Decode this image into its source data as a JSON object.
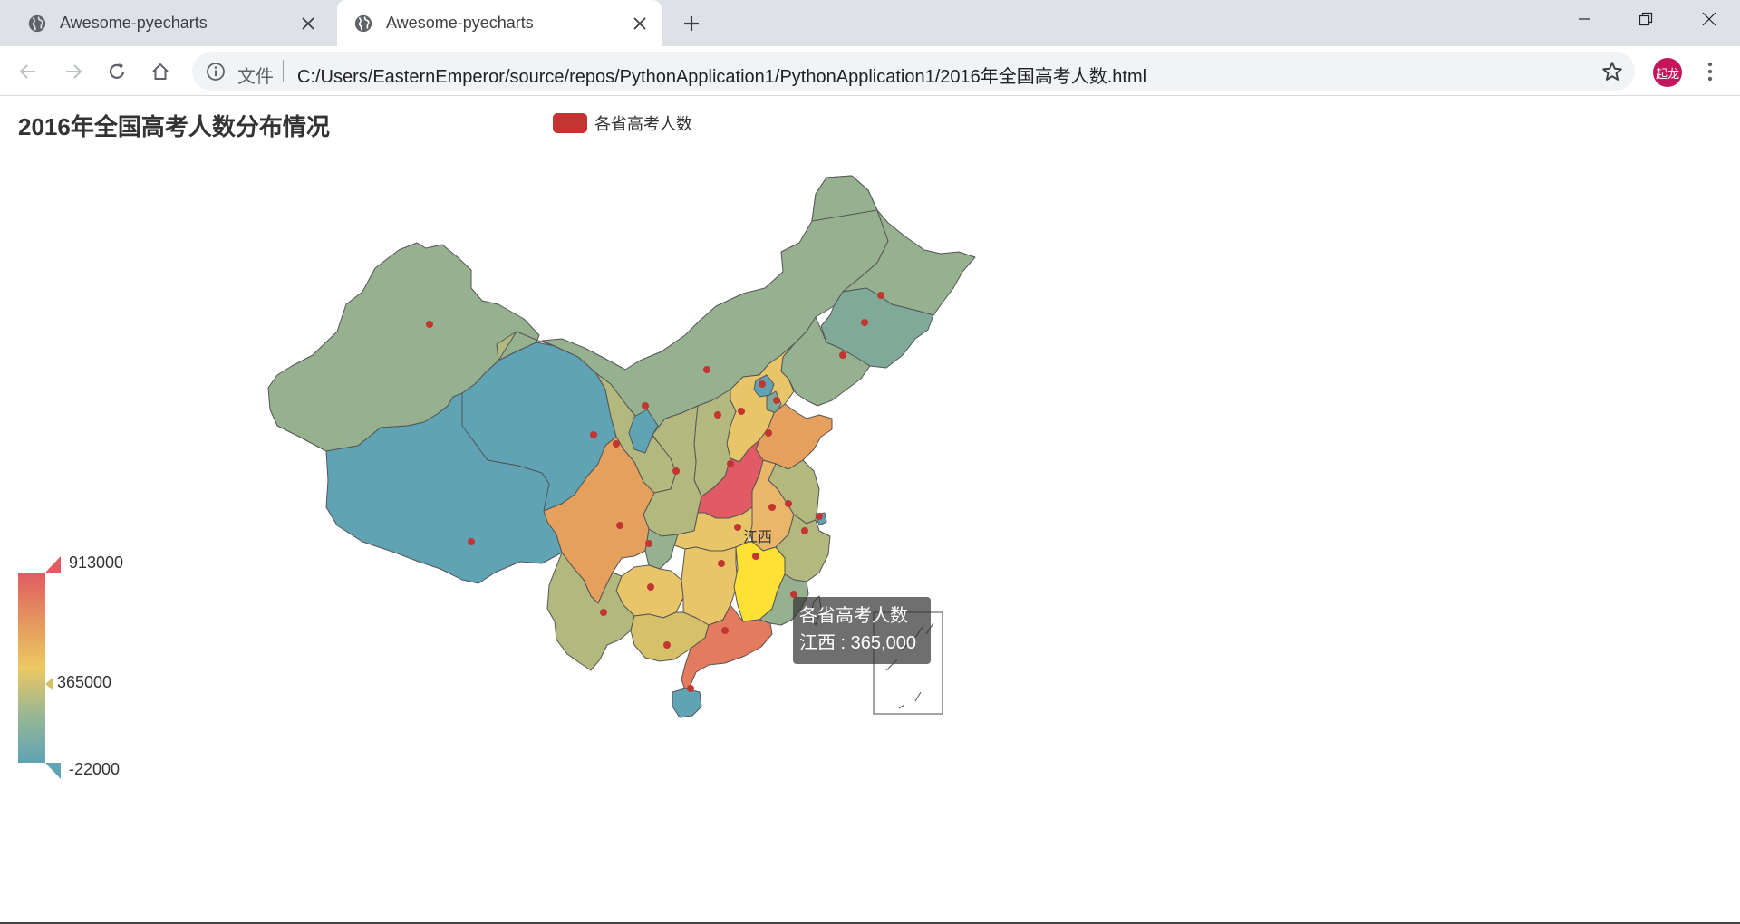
{
  "browser": {
    "tabs": [
      {
        "title": "Awesome-pyecharts",
        "active": false,
        "icon": "globe-icon"
      },
      {
        "title": "Awesome-pyecharts",
        "active": true,
        "icon": "globe-icon"
      }
    ],
    "address": {
      "scheme_label": "文件",
      "url": "C:/Users/EasternEmperor/source/repos/PythonApplication1/PythonApplication1/2016年全国高考人数.html"
    },
    "profile_initials": "起龙"
  },
  "chart_data": {
    "type": "map",
    "title": "2016年全国高考人数分布情况",
    "legend": [
      "各省高考人数"
    ],
    "legend_color": "#c23531",
    "visual_map": {
      "max": 913000,
      "min": -22000,
      "current": 365000,
      "max_label": "913000",
      "min_label": "-22000",
      "current_label": "365000",
      "colors": [
        "#5fa3b4",
        "#98b793",
        "#ecc862",
        "#e5a05e",
        "#e05b63"
      ]
    },
    "highlighted_region": "江西",
    "highlight_color": "#ffe034",
    "tooltip": {
      "series_name": "各省高考人数",
      "line": "江西 : 365,000"
    }
  }
}
